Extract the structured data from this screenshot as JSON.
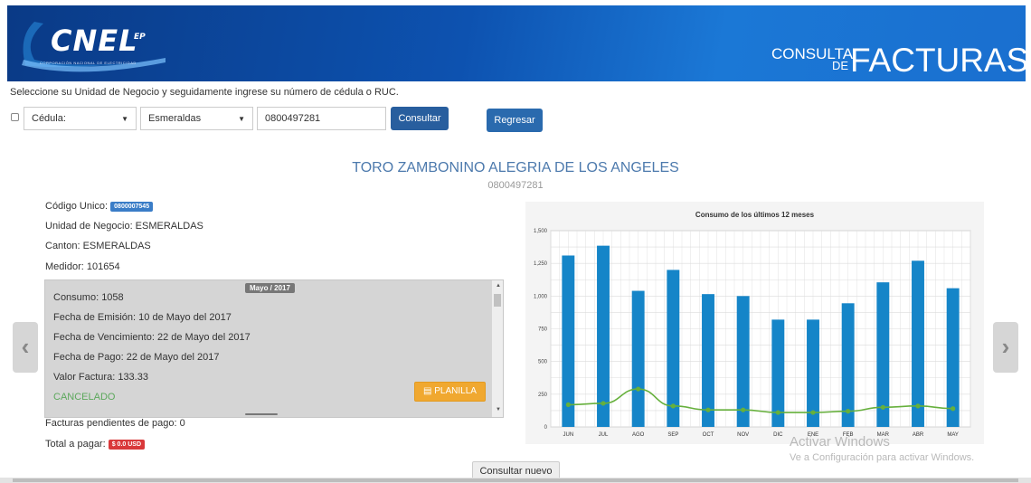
{
  "header": {
    "logo_main": "CNEL",
    "logo_suffix": "EP",
    "logo_subtitle": "CORPORACIÓN NACIONAL DE ELECTRICIDAD",
    "title_consulta": "CONSULTA",
    "title_de": "DE",
    "title_facturas": "FACTURAS",
    "brand_color": "#0d52b0"
  },
  "instructions": "Seleccione su Unidad de Negocio y seguidamente ingrese su número de cédula o RUC.",
  "form": {
    "id_type_value": "Cédula:",
    "business_unit_value": "Esmeraldas",
    "id_number_value": "0800497281",
    "consultar_label": "Consultar",
    "regresar_label": "Regresar"
  },
  "customer": {
    "name": "TORO ZAMBONINO ALEGRIA DE LOS ANGELES",
    "id": "0800497281",
    "codigo_label": "Código Unico:",
    "codigo_value": "0800007545",
    "unidad": "Unidad de Negocio: ESMERALDAS",
    "canton": "Canton: ESMERALDAS",
    "medidor": "Medidor: 101654"
  },
  "invoice": {
    "period": "Mayo / 2017",
    "consumo": "Consumo: 1058",
    "emision": "Fecha de Emisión: 10 de Mayo del 2017",
    "vencimiento": "Fecha de Vencimiento: 22 de Mayo del 2017",
    "pago": "Fecha de Pago: 22 de Mayo del 2017",
    "valor": "Valor Factura: 133.33",
    "status": "CANCELADO",
    "planilla_label": "PLANILLA"
  },
  "summary": {
    "pendientes": "Facturas pendientes de pago: 0",
    "total_label": "Total a pagar:",
    "total_value": "$ 0.0 USD"
  },
  "chart_data": {
    "type": "bar",
    "title": "Consumo de los últimos 12 meses",
    "categories": [
      "JUN",
      "JUL",
      "AGO",
      "SEP",
      "OCT",
      "NOV",
      "DIC",
      "ENE",
      "FEB",
      "MAR",
      "ABR",
      "MAY"
    ],
    "series": [
      {
        "type": "bar",
        "values": [
          1310,
          1385,
          1040,
          1200,
          1015,
          1000,
          820,
          820,
          945,
          1105,
          1270,
          1060
        ],
        "color": "#1585c8"
      },
      {
        "type": "line",
        "values": [
          170,
          180,
          290,
          160,
          130,
          130,
          110,
          110,
          120,
          150,
          160,
          140
        ],
        "color": "#66b03c"
      }
    ],
    "ylim": [
      0,
      1500
    ],
    "yticks": [
      "0",
      "250",
      "500",
      "750",
      "1,000",
      "1,250",
      "1,500"
    ],
    "grid": true
  },
  "watermark": {
    "line1": "Activar Windows",
    "line2": "Ve a Configuración para activar Windows."
  },
  "consultar_nuevo_label": "Consultar nuevo",
  "nav": {
    "prev": "‹",
    "next": "›"
  }
}
